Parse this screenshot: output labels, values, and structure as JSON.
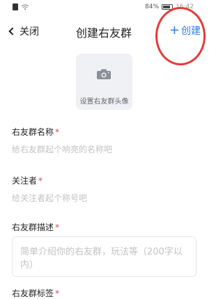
{
  "status": {
    "battery": "84%",
    "time": "16:42"
  },
  "nav": {
    "back_label": "关闭",
    "title": "创建右友群",
    "create_label": "创建",
    "create_plus": "+"
  },
  "avatar": {
    "label": "设置右友群头像"
  },
  "fields": {
    "name": {
      "label": "右友群名称",
      "required": "*",
      "placeholder": "给右友群起个响亮的名称吧"
    },
    "followers": {
      "label": "关注者",
      "required": "*",
      "placeholder": "给关注者起个称号吧"
    },
    "description": {
      "label": "右友群描述",
      "required": "*",
      "placeholder": "简单介绍你的右友群，玩法等（200字以内）"
    },
    "tags": {
      "label": "右友群标签",
      "required": "*"
    }
  },
  "colors": {
    "accent": "#2f7bf0",
    "required": "#e2433b",
    "annotation": "#e23b3b"
  }
}
